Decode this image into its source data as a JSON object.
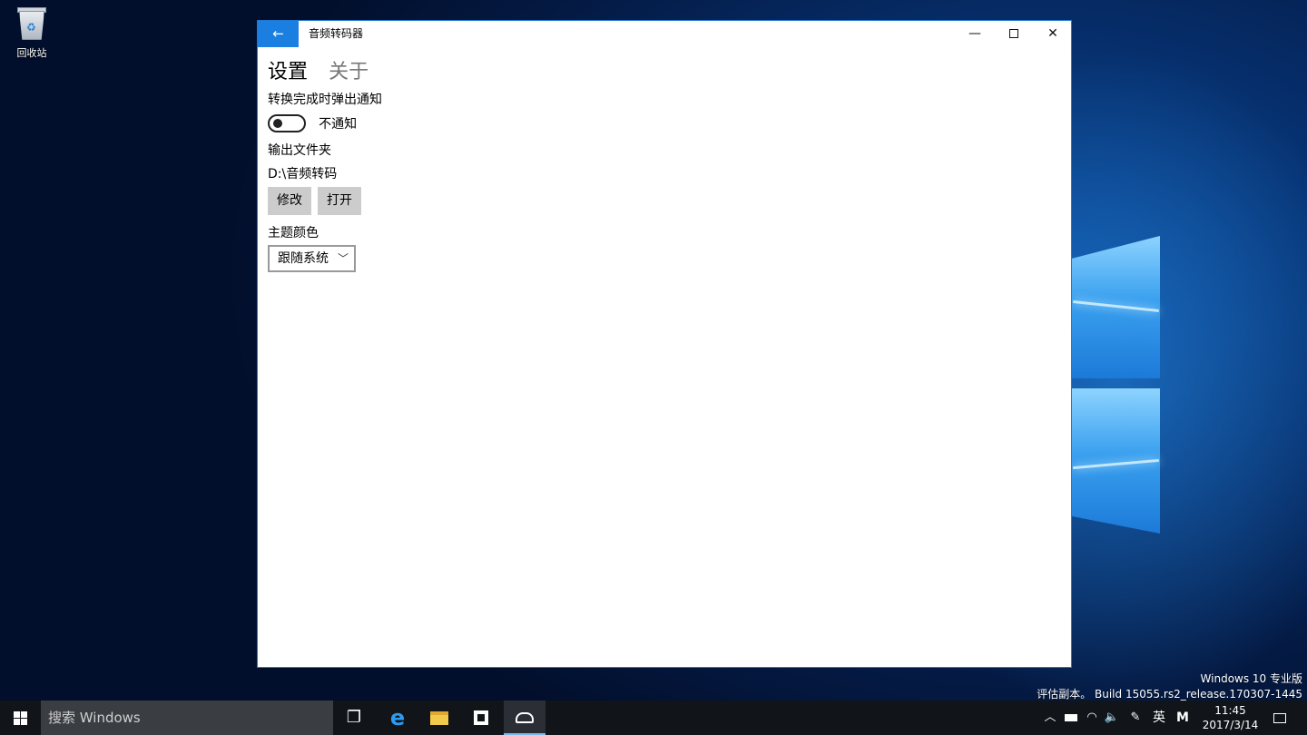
{
  "desktop": {
    "icons": [
      {
        "label": "回收站",
        "icon": "recycle-bin-icon"
      }
    ],
    "watermark": {
      "line1": "Windows 10 专业版",
      "line2": "评估副本。 Build 15055.rs2_release.170307-1445"
    }
  },
  "window": {
    "title": "音频转码器",
    "back_icon": "back-arrow-icon",
    "caption_buttons": [
      "minimize",
      "maximize",
      "close"
    ],
    "tabs": [
      {
        "label": "设置",
        "active": true
      },
      {
        "label": "关于",
        "active": false
      }
    ],
    "settings": {
      "notify_heading": "转换完成时弹出通知",
      "notify_toggle_state": "off",
      "notify_toggle_label": "不通知",
      "output_folder_heading": "输出文件夹",
      "output_folder_path": "D:\\音频转码",
      "modify_button": "修改",
      "open_button": "打开",
      "theme_heading": "主题颜色",
      "theme_selected": "跟随系统"
    }
  },
  "taskbar": {
    "search_placeholder": "搜索 Windows",
    "pinned": [
      "task-view-icon",
      "edge-icon",
      "file-explorer-icon",
      "store-icon",
      "audio-converter-icon"
    ],
    "tray": {
      "ime": "英",
      "ime_mode": "M",
      "time": "11:45",
      "date": "2017/3/14"
    }
  },
  "colors": {
    "accent": "#1a7fe0",
    "window_border": "#1f78d1",
    "button_bg": "#cccccc",
    "taskbar_bg": "#111418"
  }
}
